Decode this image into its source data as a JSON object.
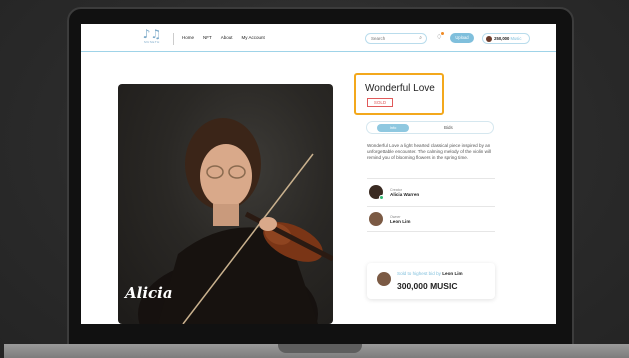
{
  "brand": {
    "logo_text": "MUSETH",
    "accent": "#7fbfdc",
    "highlight": "#f3a81c"
  },
  "nav": {
    "links": [
      "Home",
      "NFT",
      "About",
      "My Account"
    ],
    "search_placeholder": "Search",
    "upload_label": "Upload",
    "wallet_amount": "250,000",
    "wallet_unit": "Music"
  },
  "artwork": {
    "caption": "Alicia"
  },
  "item": {
    "title": "Wonderful Love",
    "status": "SOLD",
    "tabs": [
      "Info",
      "Bids"
    ],
    "description": "Wonderful Love a light hearted classical piece inspired by an unforgettable encounter.  The calming melody of the violin will remind you of blooming flowers in the spring time.",
    "creator": {
      "role": "Creator",
      "name": "Alicia Warren"
    },
    "owner": {
      "role": "Owner",
      "name": "Leon Lim"
    },
    "sale": {
      "text": "Sold to highest bid by",
      "buyer": "Leon Lim",
      "amount": "300,000 MUSIC"
    }
  }
}
